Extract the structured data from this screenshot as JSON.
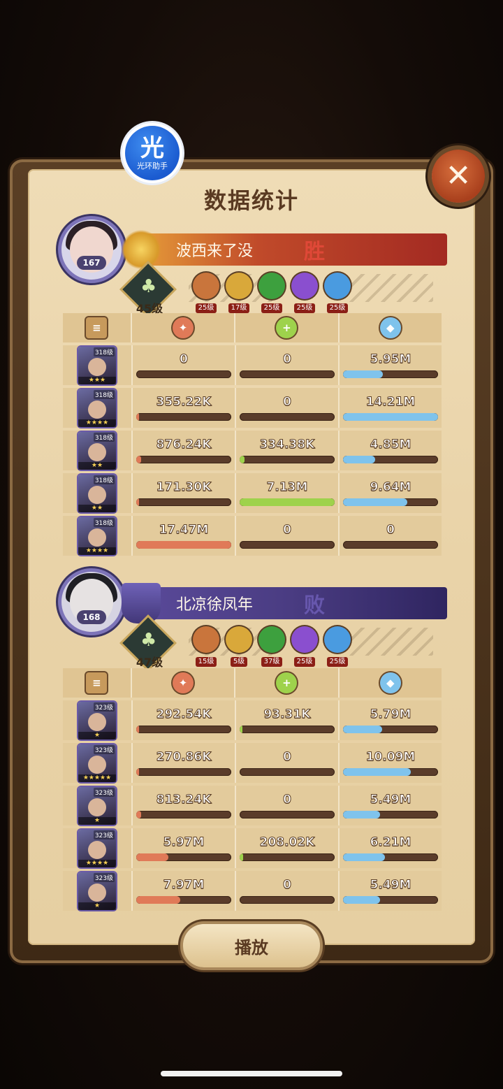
{
  "overlay_badge": {
    "glyph": "光",
    "label": "光环助手"
  },
  "title": "数据统计",
  "close_glyph": "✕",
  "stat_header_icons": [
    "damage-icon",
    "heal-icon",
    "shield-icon"
  ],
  "teams": [
    {
      "player_level": "167",
      "name": "波西来了没",
      "result": "胜",
      "faction_level": "45级",
      "furniture_levels": [
        "25级",
        "17级",
        "25级",
        "25级",
        "25级"
      ],
      "heroes": [
        {
          "level": "318级",
          "stars": "★★★",
          "damage": "0",
          "healing": "0",
          "shield": "5.95M",
          "damage_ratio": 0,
          "healing_ratio": 0,
          "shield_ratio": 0.42
        },
        {
          "level": "318级",
          "stars": "★★★★",
          "damage": "355.22K",
          "healing": "0",
          "shield": "14.21M",
          "damage_ratio": 0.02,
          "healing_ratio": 0,
          "shield_ratio": 1.0
        },
        {
          "level": "318级",
          "stars": "★★",
          "damage": "876.24K",
          "healing": "334.38K",
          "shield": "4.85M",
          "damage_ratio": 0.05,
          "healing_ratio": 0.05,
          "shield_ratio": 0.34
        },
        {
          "level": "318级",
          "stars": "★★",
          "damage": "171.30K",
          "healing": "7.13M",
          "shield": "9.64M",
          "damage_ratio": 0.01,
          "healing_ratio": 1.0,
          "shield_ratio": 0.68
        },
        {
          "level": "318级",
          "stars": "★★★★",
          "damage": "17.47M",
          "healing": "0",
          "shield": "0",
          "damage_ratio": 1.0,
          "healing_ratio": 0,
          "shield_ratio": 0
        }
      ]
    },
    {
      "player_level": "168",
      "name": "北凉徐凤年",
      "result": "败",
      "faction_level": "47级",
      "furniture_levels": [
        "15级",
        "5级",
        "37级",
        "25级",
        "25级"
      ],
      "heroes": [
        {
          "level": "323级",
          "stars": "★",
          "damage": "292.54K",
          "healing": "93.31K",
          "shield": "5.79M",
          "damage_ratio": 0.03,
          "healing_ratio": 0.02,
          "shield_ratio": 0.41
        },
        {
          "level": "323级",
          "stars": "★★★★★",
          "damage": "270.86K",
          "healing": "0",
          "shield": "10.09M",
          "damage_ratio": 0.03,
          "healing_ratio": 0,
          "shield_ratio": 0.71
        },
        {
          "level": "323级",
          "stars": "★",
          "damage": "813.24K",
          "healing": "0",
          "shield": "5.49M",
          "damage_ratio": 0.05,
          "healing_ratio": 0,
          "shield_ratio": 0.39
        },
        {
          "level": "323级",
          "stars": "★★★★",
          "damage": "5.97M",
          "healing": "208.02K",
          "shield": "6.21M",
          "damage_ratio": 0.34,
          "healing_ratio": 0.04,
          "shield_ratio": 0.44
        },
        {
          "level": "323级",
          "stars": "★",
          "damage": "7.97M",
          "healing": "0",
          "shield": "5.49M",
          "damage_ratio": 0.46,
          "healing_ratio": 0,
          "shield_ratio": 0.39
        }
      ]
    }
  ],
  "play_label": "播放",
  "colors": {
    "damage_bar": "#e07a58",
    "healing_bar": "#9ed24c",
    "shield_bar": "#7fc3ec",
    "win_banner": "#b83a26",
    "lose_banner": "#4a3c82",
    "furniture": [
      "#c9753c",
      "#d9a83a",
      "#3da03e",
      "#8a4fcf",
      "#4a9be0"
    ]
  }
}
